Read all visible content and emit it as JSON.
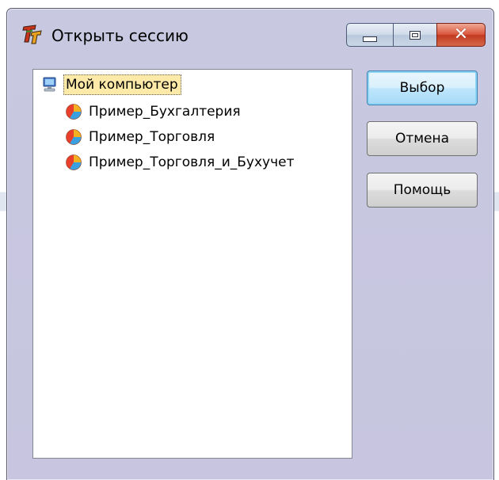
{
  "window": {
    "title": "Открыть сессию"
  },
  "tree": {
    "root": {
      "label": "Мой компьютер",
      "icon": "computer-icon"
    },
    "items": [
      {
        "label": "Пример_Бухгалтерия",
        "icon": "database-icon"
      },
      {
        "label": "Пример_Торговля",
        "icon": "database-icon"
      },
      {
        "label": "Пример_Торговля_и_Бухучет",
        "icon": "database-icon"
      }
    ]
  },
  "buttons": {
    "ok_label": "Выбор",
    "cancel_label": "Отмена",
    "help_label": "Помощь"
  },
  "colors": {
    "window_bg": "#c7c5df",
    "selection_bg": "#fde9a8",
    "close_button": "#c23a20",
    "default_button_border": "#3c7fb1"
  }
}
